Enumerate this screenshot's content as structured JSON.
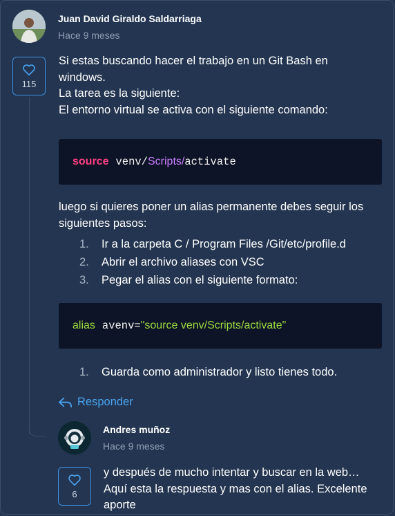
{
  "comment": {
    "author": "Juan David Giraldo Saldarriaga",
    "time": "Hace 9 meses",
    "likes": "115",
    "paragraph_lines": [
      "Si estas buscando hacer el trabajo en un Git Bash en",
      "windows.",
      "La tarea es la siguiente:",
      "El entorno virtual se activa con el siguiente comando:"
    ],
    "code1": {
      "keyword": "source",
      "pre": "venv/",
      "highlight": "Scripts/",
      "post": "activate"
    },
    "paragraph2_lines": [
      "luego si quieres poner un alias permanente debes seguir los",
      "siguientes pasos:"
    ],
    "steps": [
      {
        "num": "1.",
        "text": "Ir a la carpeta C / Program Files /Git/etc/profile.d"
      },
      {
        "num": "2.",
        "text": "Abrir el archivo aliases con VSC"
      },
      {
        "num": "3.",
        "text": "Pegar el alias con el siguiente formato:"
      }
    ],
    "code2": {
      "keyword": "alias",
      "name": "avenv=",
      "value": "\"source venv/Scripts/activate\""
    },
    "steps2": [
      {
        "num": "1.",
        "text": "Guarda como administrador y listo tienes todo."
      }
    ],
    "reply_label": "Responder"
  },
  "reply": {
    "author": "Andres muñoz",
    "time": "Hace 9 meses",
    "likes": "6",
    "text_lines": [
      "y después de mucho intentar y buscar en la web…",
      "Aquí esta la respuesta y mas con el alias. Excelente",
      "aporte"
    ]
  },
  "colors": {
    "background": "#233550",
    "accent": "#3e93e6",
    "code_bg": "#0e1427"
  }
}
